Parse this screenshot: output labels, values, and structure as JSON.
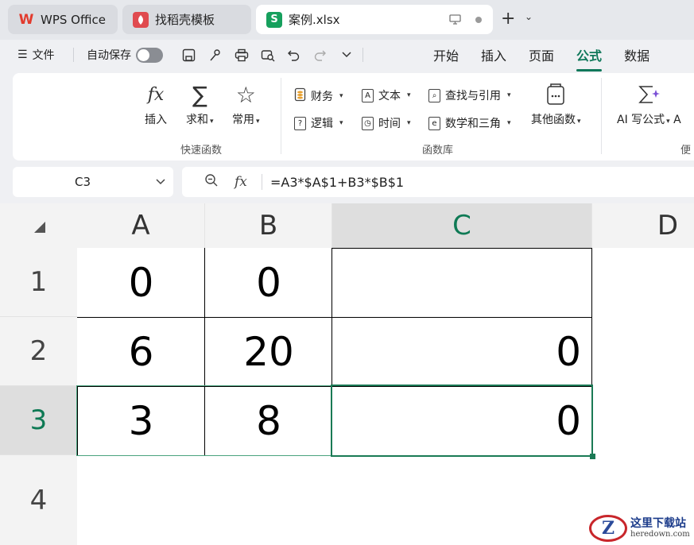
{
  "tabs": [
    {
      "label": "WPS Office"
    },
    {
      "label": "找稻壳模板"
    },
    {
      "label": "案例.xlsx"
    }
  ],
  "menu": {
    "file_label": "文件",
    "autosave_label": "自动保存",
    "ribbon_tabs": [
      "开始",
      "插入",
      "页面",
      "公式",
      "数据"
    ],
    "active_tab": "公式"
  },
  "ribbon": {
    "quick": {
      "insert_label": "插入",
      "sum_label": "求和",
      "common_label": "常用",
      "group_label": "快速函数"
    },
    "library": {
      "finance_label": "财务",
      "text_label": "文本",
      "lookup_label": "查找与引用",
      "logic_label": "逻辑",
      "time_label": "时间",
      "math_label": "数学和三角",
      "other_label": "其他函数",
      "group_label": "函数库"
    },
    "ai": {
      "ai_formula_label": "AI 写公式",
      "extra_label": "A",
      "group_label": "便"
    }
  },
  "formula_bar": {
    "cell_ref": "C3",
    "fx_label": "fx",
    "formula": "=A3*$A$1+B3*$B$1"
  },
  "grid": {
    "columns": [
      "A",
      "B",
      "C",
      "D"
    ],
    "selected_column": "C",
    "rows": [
      "1",
      "2",
      "3",
      "4"
    ],
    "selected_row": "3",
    "cells": {
      "A1": "0",
      "B1": "0",
      "C1": "",
      "A2": "6",
      "B2": "20",
      "C2": "0",
      "A3": "3",
      "B3": "8",
      "C3": "0"
    }
  },
  "watermark": {
    "badge": "Z",
    "title": "这里下载站",
    "domain": "heredown.com"
  },
  "colors": {
    "accent": "#10785a",
    "selection": "#1a7a55"
  }
}
